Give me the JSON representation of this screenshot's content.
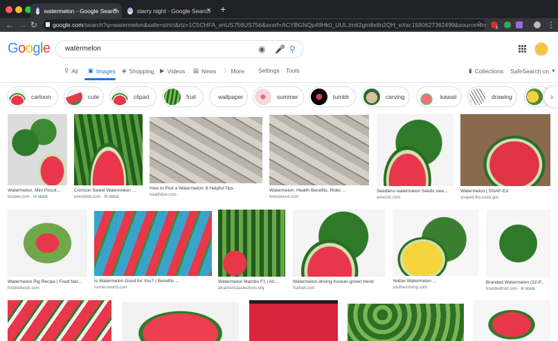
{
  "browser": {
    "tabs": [
      {
        "title": "watermelon - Google Search",
        "active": true
      },
      {
        "title": "starry night - Google Search",
        "active": false
      }
    ],
    "new_tab": "+",
    "url_host": "google.com",
    "url_rest": "/search?q=watermelon&safe=strict&rlz=1C5CHFA_enUS756US756&sxsrf=ACYBGNQp49Hk0_UULJm62gm8x8n2QH_eXw:1580627362499&source=lnms&t...",
    "extension_badge": "1"
  },
  "google": {
    "logo_letters": [
      {
        "ch": "G",
        "color": "#4285f4"
      },
      {
        "ch": "o",
        "color": "#ea4335"
      },
      {
        "ch": "o",
        "color": "#fbbc05"
      },
      {
        "ch": "g",
        "color": "#4285f4"
      },
      {
        "ch": "l",
        "color": "#34a853"
      },
      {
        "ch": "e",
        "color": "#ea4335"
      }
    ],
    "query": "watermelon",
    "tabs": [
      "All",
      "Images",
      "Shopping",
      "Videos",
      "News",
      "More"
    ],
    "settings": "Settings",
    "tools": "Tools",
    "collections": "Collections",
    "safesearch": "SafeSearch on"
  },
  "chips": [
    {
      "label": "cartoon",
      "thumb": "melonslice"
    },
    {
      "label": "cute",
      "thumb": "wedge"
    },
    {
      "label": "clipart",
      "thumb": "melonslice"
    },
    {
      "label": "fruit",
      "thumb": "stripes"
    },
    {
      "label": "wallpaper",
      "thumb": "none"
    },
    {
      "label": "summer",
      "thumb": "pattern"
    },
    {
      "label": "tumblr",
      "thumb": "dots"
    },
    {
      "label": "carving",
      "thumb": "face"
    },
    {
      "label": "kawaii",
      "thumb": "kawaii"
    },
    {
      "label": "drawing",
      "thumb": "sketch"
    },
    {
      "label": "",
      "thumb": "yellow"
    }
  ],
  "results": [
    {
      "title": "Watermelon, Mini Piccol...",
      "source": "burpee.com",
      "stock": "In stock",
      "art": "mini"
    },
    {
      "title": "Crimson Sweet Watermelon ...",
      "source": "everwilde.com",
      "stock": "In stock",
      "art": "whole-slice"
    },
    {
      "title": "How to Pick a Watermelon: 6 Helpful Tips",
      "source": "healthline.com",
      "stock": "",
      "art": "gray"
    },
    {
      "title": "Watermelon: Health Benefits, Risks ...",
      "source": "livescience.com",
      "stock": "",
      "art": "gray"
    },
    {
      "title": "Seedless watermelon Seeds swe...",
      "source": "amazon.com",
      "stock": "",
      "art": "whole-slice-white"
    },
    {
      "title": "Watermelon | SNAP-Ed",
      "source": "snaped.fns.usda.gov",
      "stock": "",
      "art": "wood"
    },
    {
      "title": "Watermelon Pig Recipe | Food Net...",
      "source": "foodnetwork.com",
      "stock": "",
      "art": "pig"
    },
    {
      "title": "Is Watermelon Good for You? | Benefits ...",
      "source": "runnersworld.com",
      "stock": "",
      "art": "blue"
    },
    {
      "title": "Watermelon Mambo F1 | All...",
      "source": "all-americaselections.org",
      "stock": "",
      "art": "mambo"
    },
    {
      "title": "Watermelon driving Korean-grown trend",
      "source": "fruitnet.com",
      "stock": "",
      "art": "whole-slice-white"
    },
    {
      "title": "Yellow Watermelon ...",
      "source": "southernliving.com",
      "stock": "",
      "art": "yellow"
    },
    {
      "title": "Branded Watermelon (32-P...",
      "source": "brandedfruit.com",
      "stock": "In stock",
      "art": "whole-white"
    },
    {
      "title": "",
      "source": "",
      "stock": "",
      "art": "wedges"
    },
    {
      "title": "",
      "source": "",
      "stock": "",
      "art": "redflat"
    },
    {
      "title": "",
      "source": "",
      "stock": "",
      "art": "closeup"
    },
    {
      "title": "",
      "source": "",
      "stock": "",
      "art": "pile"
    },
    {
      "title": "",
      "source": "",
      "stock": "",
      "art": "cut-white"
    }
  ]
}
